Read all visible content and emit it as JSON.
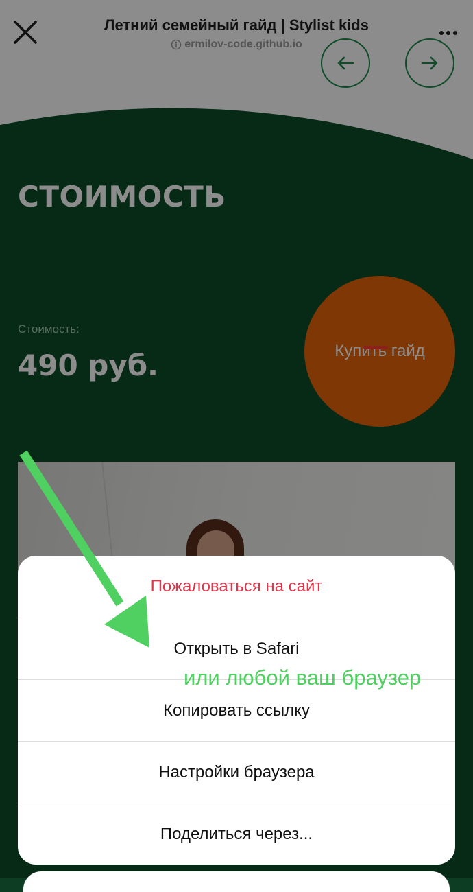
{
  "browser_header": {
    "title": "Летний семейный гайд | Stylist kids",
    "domain": "ermilov-code.github.io",
    "close_icon": "close-icon",
    "info_icon": "info-circle-icon",
    "more_icon": "more-dots-icon"
  },
  "page": {
    "section_title": "СТОИМОСТЬ",
    "price_label": "Стоимость:",
    "price_value": "490 руб.",
    "buy_button_label": "Купить гайд",
    "nav_prev_icon": "arrow-left-icon",
    "nav_next_icon": "arrow-right-icon"
  },
  "action_sheet": {
    "items": [
      {
        "label": "Пожаловаться на сайт",
        "style": "destructive"
      },
      {
        "label": "Открыть в Safari",
        "style": "default"
      },
      {
        "label": "Копировать ссылку",
        "style": "default"
      },
      {
        "label": "Настройки браузера",
        "style": "default"
      },
      {
        "label": "Поделиться через...",
        "style": "default"
      }
    ]
  },
  "annotation": {
    "hint_text": "или любой ваш браузер",
    "arrow_icon": "annotation-arrow-icon"
  },
  "colors": {
    "section_green": "#0d4d29",
    "buy_button": "#e8650a",
    "nav_arrow": "#1e8a4c",
    "destructive": "#e0364a",
    "annotation": "#4fd060"
  }
}
